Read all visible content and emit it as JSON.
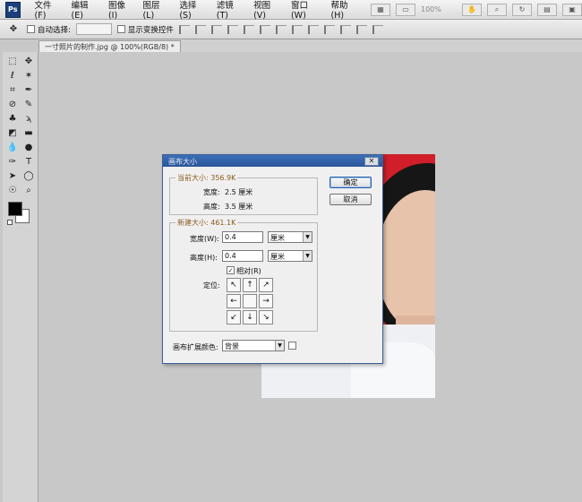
{
  "app": {
    "logo_text": "Ps"
  },
  "menu": {
    "items": [
      "文件(F)",
      "编辑(E)",
      "图像(I)",
      "图层(L)",
      "选择(S)",
      "滤镜(T)",
      "视图(V)",
      "窗口(W)",
      "帮助(H)"
    ],
    "zoom": "100%"
  },
  "options_bar": {
    "auto_select_label": "自动选择:",
    "show_transform_label": "显示变换控件"
  },
  "document": {
    "tab_title": "一寸照片的制作.jpg @ 100%(RGB/8) *"
  },
  "dialog": {
    "title": "画布大小",
    "current_size": {
      "legend": "当前大小: 356.9K",
      "width_label": "宽度:",
      "width_value": "2.5 厘米",
      "height_label": "高度:",
      "height_value": "3.5 厘米"
    },
    "new_size": {
      "legend": "新建大小: 461.1K",
      "width_label": "宽度(W):",
      "width_value": "0.4",
      "width_unit": "厘米",
      "height_label": "高度(H):",
      "height_value": "0.4",
      "height_unit": "厘米",
      "relative_label": "相对(R)",
      "relative_checked": true,
      "anchor_label": "定位:",
      "anchor_arrows": [
        "↖",
        "↑",
        "↗",
        "←",
        "",
        "→",
        "↙",
        "↓",
        "↘"
      ]
    },
    "ext_color_label": "画布扩展颜色:",
    "ext_color_value": "背景",
    "ok_button": "确定",
    "cancel_button": "取消"
  },
  "colors": {
    "canvas_bg": "#c8c8c8",
    "photo_bg": "#d01f2a",
    "dialog_title": "#2a5598"
  }
}
